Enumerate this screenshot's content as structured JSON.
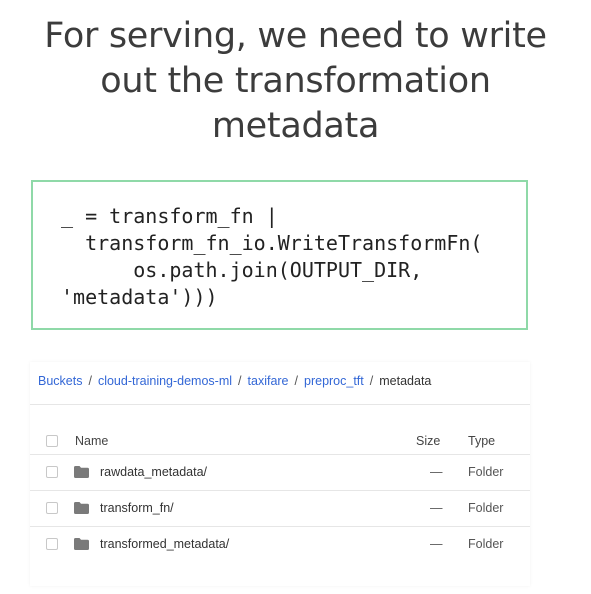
{
  "title": {
    "line1": "For serving, we need to write",
    "line2": "out the transformation",
    "line3": "metadata"
  },
  "code": {
    "line1": "_ = transform_fn |",
    "line2": "  transform_fn_io.WriteTransformFn(",
    "line3": "      os.path.join(OUTPUT_DIR,",
    "line4": "'metadata')))"
  },
  "breadcrumb": {
    "items": [
      "Buckets",
      "cloud-training-demos-ml",
      "taxifare",
      "preproc_tft"
    ],
    "current": "metadata",
    "separator": "/"
  },
  "table": {
    "headers": {
      "name": "Name",
      "size": "Size",
      "type": "Type"
    },
    "rows": [
      {
        "name": "rawdata_metadata/",
        "size": "—",
        "type": "Folder",
        "icon": "folder-icon"
      },
      {
        "name": "transform_fn/",
        "size": "—",
        "type": "Folder",
        "icon": "folder-icon"
      },
      {
        "name": "transformed_metadata/",
        "size": "—",
        "type": "Folder",
        "icon": "folder-icon"
      }
    ]
  },
  "colors": {
    "code_border": "#8fd9a8",
    "link": "#3367d6",
    "folder": "#7a7a7a"
  }
}
